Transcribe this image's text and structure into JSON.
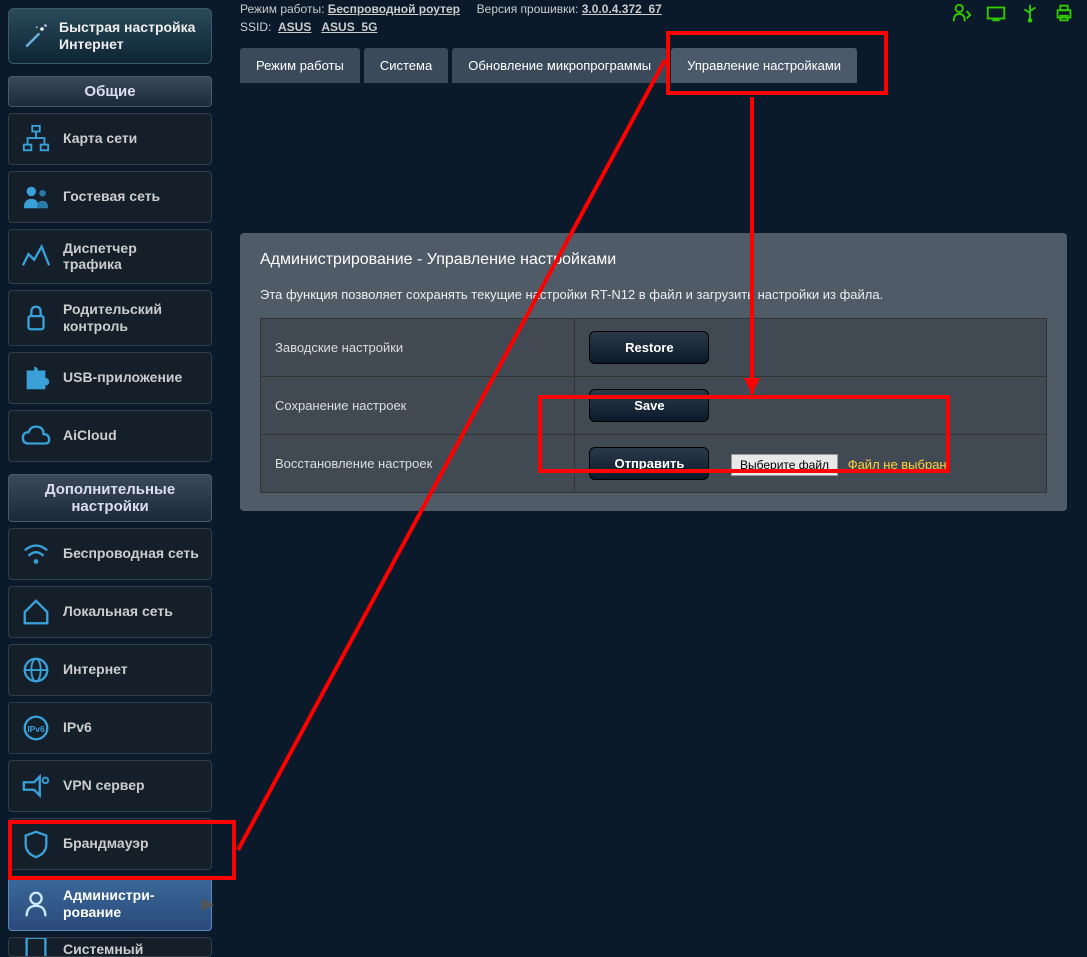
{
  "qis_label": "Быстрая настройка Интернет",
  "menu_general_header": "Общие",
  "menu_general": [
    {
      "label": "Карта сети"
    },
    {
      "label": "Гостевая сеть"
    },
    {
      "label": "Диспетчер трафика"
    },
    {
      "label": "Родительский контроль"
    },
    {
      "label": "USB-приложение"
    },
    {
      "label": "AiCloud"
    }
  ],
  "menu_adv_header": "Дополнительные настройки",
  "menu_adv": [
    {
      "label": "Беспроводная сеть"
    },
    {
      "label": "Локальная сеть"
    },
    {
      "label": "Интернет"
    },
    {
      "label": "IPv6"
    },
    {
      "label": "VPN сервер"
    },
    {
      "label": "Брандмауэр"
    },
    {
      "label": "Администри-рование"
    },
    {
      "label": "Системный"
    }
  ],
  "status": {
    "op_mode_label": "Режим работы:",
    "op_mode_value": "Беспроводной роутер",
    "fw_label": "Версия прошивки:",
    "fw_value": "3.0.0.4.372_67",
    "ssid_label": "SSID:",
    "ssid_1": "ASUS",
    "ssid_2": "ASUS_5G"
  },
  "tabs": [
    {
      "label": "Режим работы"
    },
    {
      "label": "Система"
    },
    {
      "label": "Обновление микропрограммы"
    },
    {
      "label": "Управление настройками"
    }
  ],
  "content": {
    "title": "Администрирование - Управление настройками",
    "desc": "Эта функция позволяет сохранять текущие настройки RT-N12 в файл и загрузить настройки из файла.",
    "rows": {
      "factory_label": "Заводские настройки",
      "restore_btn": "Restore",
      "save_label": "Сохранение настроек",
      "save_btn": "Save",
      "restore_label": "Восстановление настроек",
      "upload_btn": "Отправить",
      "file_btn": "Выберите файл",
      "file_status": "Файл не выбран"
    }
  }
}
